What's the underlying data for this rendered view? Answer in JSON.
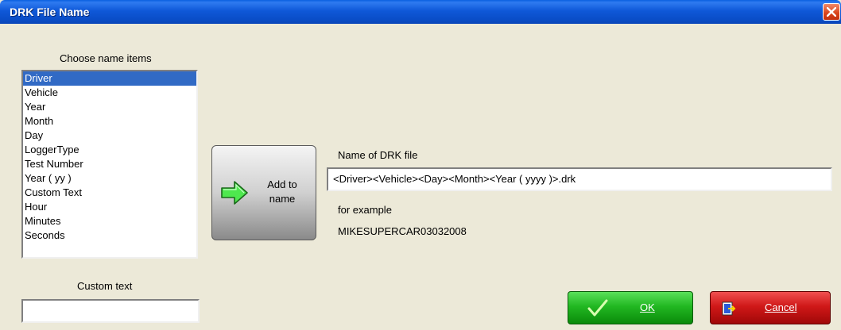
{
  "window": {
    "title": "DRK File Name"
  },
  "left": {
    "choose_label": "Choose name items",
    "items": [
      "Driver",
      "Vehicle",
      "Year",
      "Month",
      "Day",
      "LoggerType",
      "Test Number",
      "Year ( yy )",
      "Custom Text",
      "Hour",
      "Minutes",
      "Seconds"
    ],
    "selected": "Driver",
    "custom_text_label": "Custom text",
    "custom_text_value": ""
  },
  "add_button": {
    "label": "Add to\nname",
    "icon": "green-arrow-right-icon"
  },
  "right": {
    "name_label": "Name of DRK file",
    "name_value": "<Driver><Vehicle><Day><Month><Year ( yyyy )>.drk",
    "example_label": "for example",
    "example_value": "MIKESUPERCAR03032008"
  },
  "buttons": {
    "ok": "OK",
    "cancel": "Cancel"
  },
  "colors": {
    "titlebar": "#0a4ec8",
    "selection": "#316ac5",
    "ok": "#22b822",
    "cancel": "#d01818"
  }
}
